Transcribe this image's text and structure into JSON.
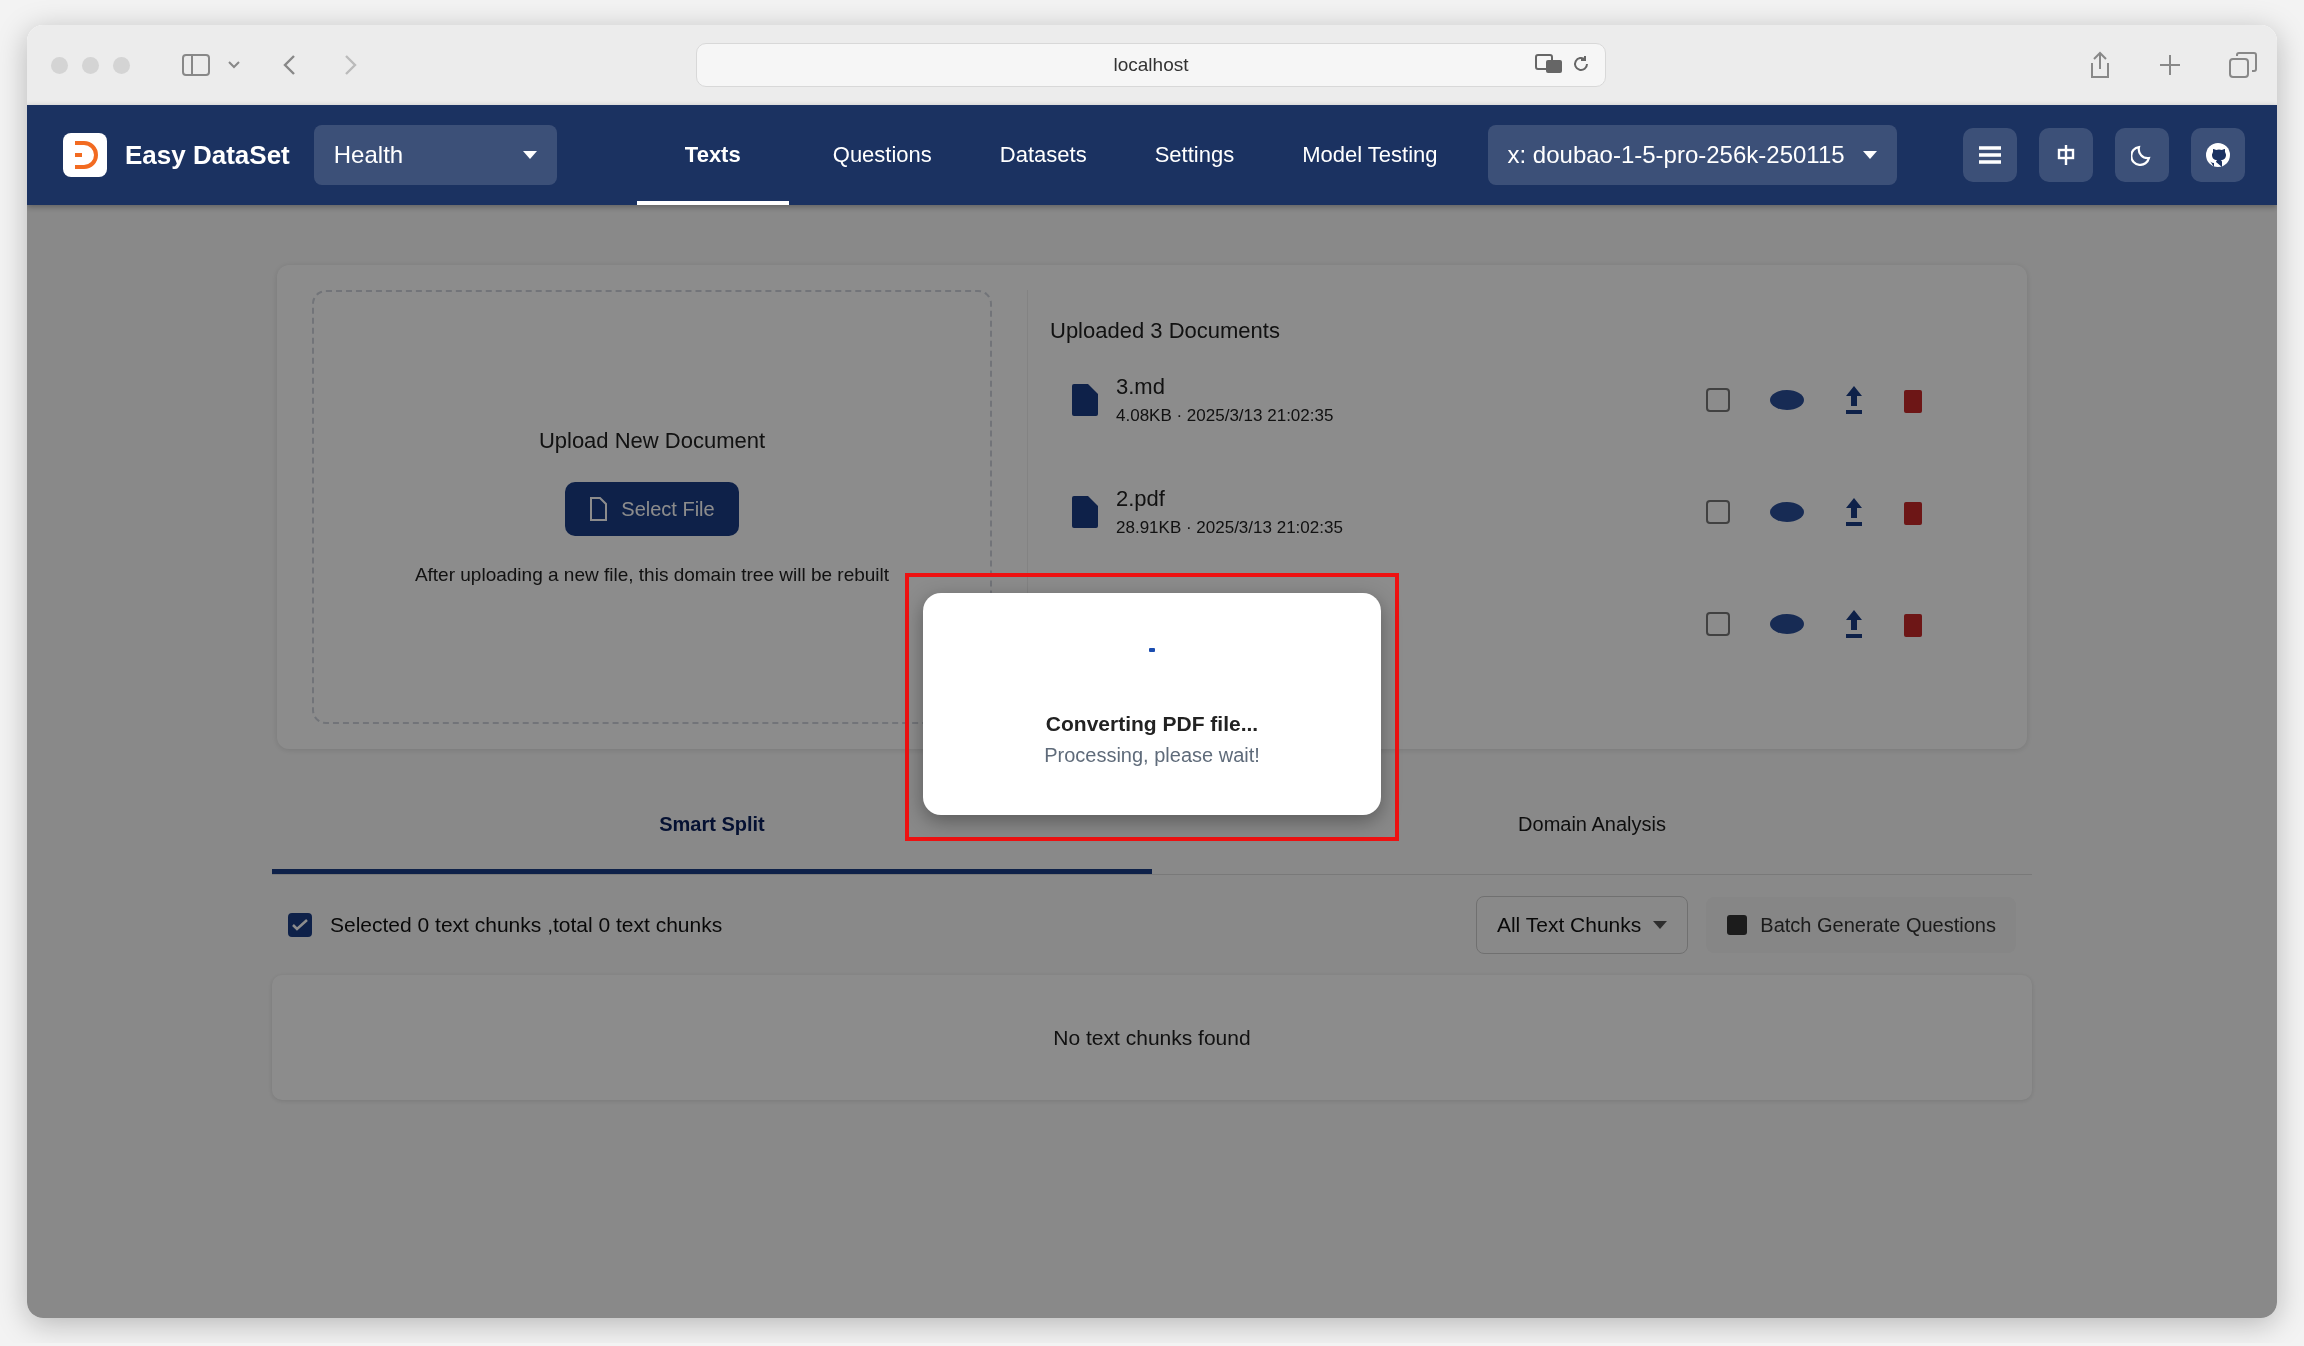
{
  "browser": {
    "url": "localhost"
  },
  "navbar": {
    "brand": "Easy DataSet",
    "project": "Health",
    "model": "x: doubao-1-5-pro-256k-250115",
    "tabs": [
      {
        "label": "Texts",
        "selected": true
      },
      {
        "label": "Questions",
        "selected": false
      },
      {
        "label": "Datasets",
        "selected": false
      },
      {
        "label": "Settings",
        "selected": false
      },
      {
        "label": "Model Testing",
        "selected": false
      }
    ]
  },
  "upload": {
    "title": "Upload New Document",
    "button": "Select File",
    "hint": "After uploading a new file, this domain tree will be rebuilt"
  },
  "documents": {
    "title": "Uploaded 3 Documents",
    "items": [
      {
        "name": "3.md",
        "meta": "4.08KB · 2025/3/13 21:02:35",
        "checked": false
      },
      {
        "name": "2.pdf",
        "meta": "28.91KB · 2025/3/13 21:02:35",
        "checked": false
      },
      {
        "checked": false
      }
    ]
  },
  "split_tabs": [
    {
      "label": "Smart Split",
      "selected": true
    },
    {
      "label": "Domain Analysis",
      "selected": false
    }
  ],
  "chunks": {
    "select_all_checked": true,
    "summary": "Selected 0 text chunks ,total 0 text chunks",
    "filter": "All Text Chunks",
    "batch_button": {
      "label": "Batch Generate Questions",
      "disabled": true
    },
    "empty": "No text chunks found"
  },
  "dialog": {
    "title": "Converting PDF file...",
    "message": "Processing, please wait!"
  }
}
